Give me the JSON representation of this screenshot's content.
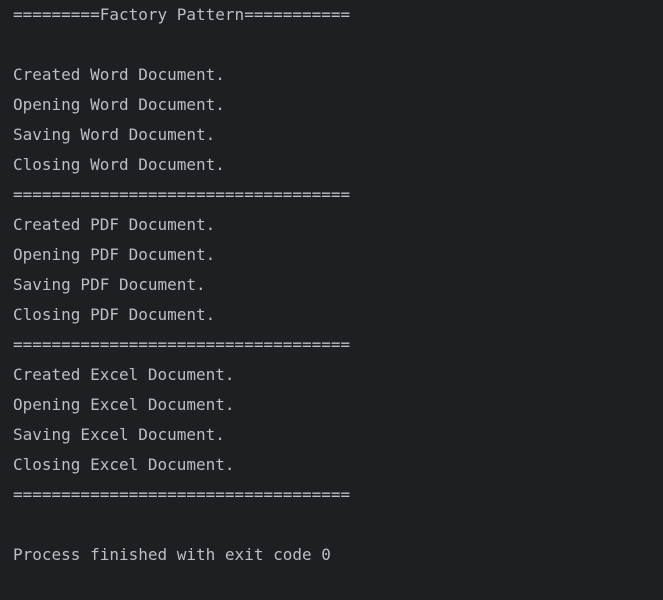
{
  "console": {
    "lines": [
      "=========Factory Pattern===========",
      "",
      "Created Word Document.",
      "Opening Word Document.",
      "Saving Word Document.",
      "Closing Word Document.",
      "===================================",
      "Created PDF Document.",
      "Opening PDF Document.",
      "Saving PDF Document.",
      "Closing PDF Document.",
      "===================================",
      "Created Excel Document.",
      "Opening Excel Document.",
      "Saving Excel Document.",
      "Closing Excel Document.",
      "===================================",
      "",
      "Process finished with exit code 0"
    ]
  },
  "colors": {
    "background": "#1e1f22",
    "text": "#bcbec4"
  }
}
